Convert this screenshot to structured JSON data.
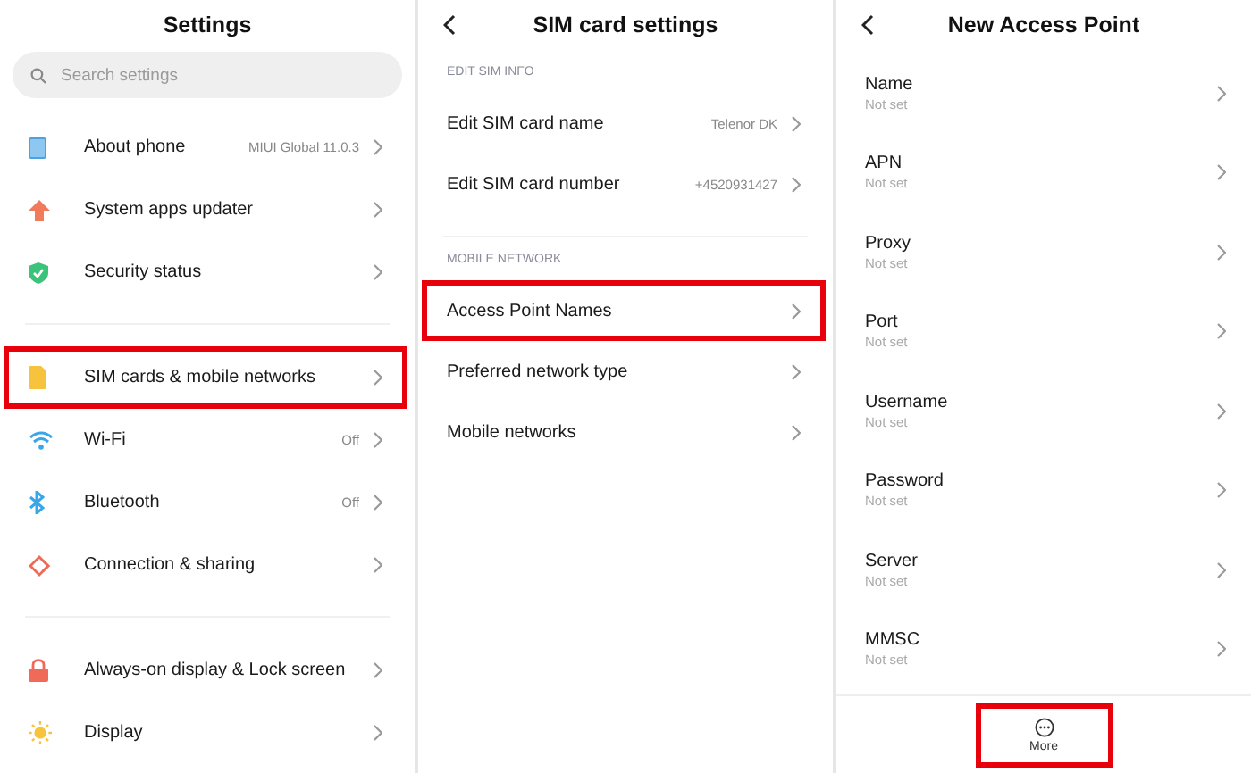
{
  "panels": [
    {
      "kind": "settings",
      "title": "Settings",
      "search": {
        "placeholder": "Search settings"
      },
      "groups": [
        [
          {
            "label": "About phone",
            "value": "MIUI Global 11.0.3",
            "highlighted": false
          },
          {
            "label": "System apps updater",
            "highlighted": false
          },
          {
            "label": "Security status",
            "highlighted": false
          }
        ],
        [
          {
            "label": "SIM cards & mobile networks",
            "highlighted": true
          },
          {
            "label": "Wi-Fi",
            "value": "Off",
            "highlighted": false
          },
          {
            "label": "Bluetooth",
            "value": "Off",
            "highlighted": false
          },
          {
            "label": "Connection & sharing",
            "highlighted": false
          }
        ],
        [
          {
            "label": "Always-on display & Lock screen",
            "highlighted": false
          },
          {
            "label": "Display",
            "highlighted": false
          }
        ]
      ]
    },
    {
      "kind": "sections",
      "title": "SIM card settings",
      "sections": [
        {
          "header": "EDIT SIM INFO",
          "items": [
            {
              "label": "Edit SIM card name",
              "value": "Telenor DK",
              "highlighted": false
            },
            {
              "label": "Edit SIM card number",
              "value": "+4520931427",
              "highlighted": false
            }
          ]
        },
        {
          "header": "MOBILE NETWORK",
          "items": [
            {
              "label": "Access Point Names",
              "highlighted": true
            },
            {
              "label": "Preferred network type",
              "highlighted": false
            },
            {
              "label": "Mobile networks",
              "highlighted": false
            }
          ]
        }
      ]
    },
    {
      "kind": "fields",
      "title": "New Access Point",
      "fields": [
        {
          "label": "Name",
          "value": "Not set"
        },
        {
          "label": "APN",
          "value": "Not set"
        },
        {
          "label": "Proxy",
          "value": "Not set"
        },
        {
          "label": "Port",
          "value": "Not set"
        },
        {
          "label": "Username",
          "value": "Not set"
        },
        {
          "label": "Password",
          "value": "Not set"
        },
        {
          "label": "Server",
          "value": "Not set"
        },
        {
          "label": "MMSC",
          "value": "Not set"
        }
      ],
      "footer": {
        "label": "More",
        "highlighted": true
      }
    }
  ]
}
